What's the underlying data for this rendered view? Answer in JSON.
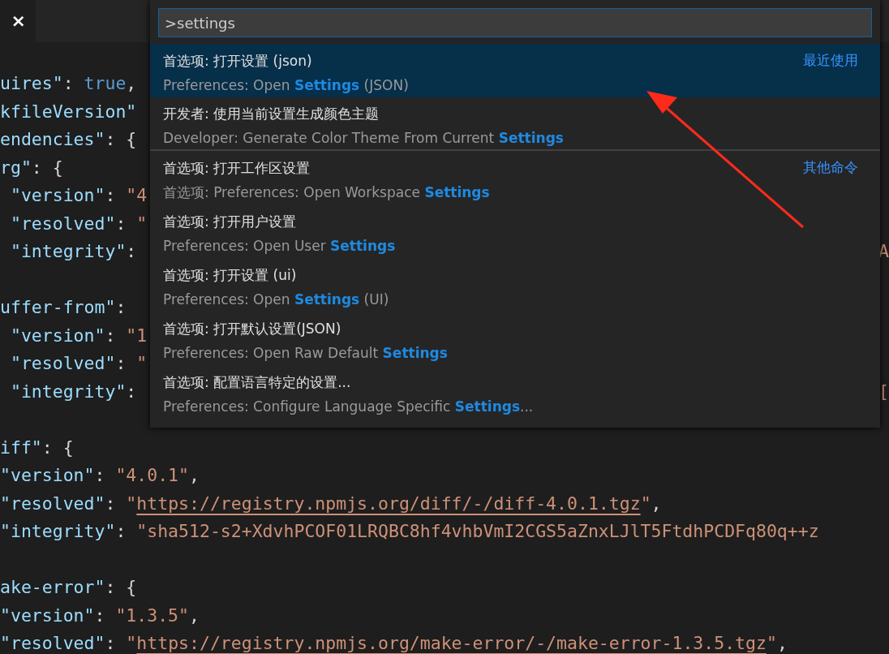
{
  "tab": {
    "close": "×"
  },
  "code_lines": [
    {
      "tokens": [
        {
          "kind": "key",
          "text": "uires\""
        },
        {
          "kind": "punct",
          "text": ": "
        },
        {
          "kind": "bool",
          "text": "true"
        },
        {
          "kind": "punct",
          "text": ","
        }
      ]
    },
    {
      "tokens": [
        {
          "kind": "key",
          "text": "kfileVersion\""
        }
      ]
    },
    {
      "tokens": [
        {
          "kind": "key",
          "text": "endencies\""
        },
        {
          "kind": "punct",
          "text": ": {"
        }
      ]
    },
    {
      "tokens": [
        {
          "kind": "key",
          "text": "rg\""
        },
        {
          "kind": "punct",
          "text": ": {"
        }
      ]
    },
    {
      "tokens": [
        {
          "kind": "key",
          "text": " \"version\""
        },
        {
          "kind": "punct",
          "text": ": "
        },
        {
          "kind": "string",
          "text": "\"4"
        }
      ]
    },
    {
      "tokens": [
        {
          "kind": "key",
          "text": " \"resolved\""
        },
        {
          "kind": "punct",
          "text": ": "
        },
        {
          "kind": "string",
          "text": "\""
        }
      ]
    },
    {
      "tokens": [
        {
          "kind": "key",
          "text": " \"integrity\""
        },
        {
          "kind": "punct",
          "text": ":"
        }
      ],
      "tail": "A"
    },
    {
      "gap_before": true,
      "tokens": [
        {
          "kind": "key",
          "text": "uffer-from\""
        },
        {
          "kind": "punct",
          "text": ":"
        }
      ]
    },
    {
      "tokens": [
        {
          "kind": "key",
          "text": " \"version\""
        },
        {
          "kind": "punct",
          "text": ": "
        },
        {
          "kind": "string",
          "text": "\"1"
        }
      ]
    },
    {
      "tokens": [
        {
          "kind": "key",
          "text": " \"resolved\""
        },
        {
          "kind": "punct",
          "text": ": "
        },
        {
          "kind": "string",
          "text": "\""
        }
      ]
    },
    {
      "tokens": [
        {
          "kind": "key",
          "text": " \"integrity\""
        },
        {
          "kind": "punct",
          "text": ":"
        }
      ],
      "tail": "["
    },
    {
      "gap_before": true,
      "tokens": [
        {
          "kind": "key",
          "text": "iff\""
        },
        {
          "kind": "punct",
          "text": ": {"
        }
      ]
    },
    {
      "tokens": [
        {
          "kind": "key",
          "text": "\"version\""
        },
        {
          "kind": "punct",
          "text": ": "
        },
        {
          "kind": "string",
          "text": "\"4.0.1\""
        },
        {
          "kind": "punct",
          "text": ","
        }
      ]
    },
    {
      "tokens": [
        {
          "kind": "key",
          "text": "\"resolved\""
        },
        {
          "kind": "punct",
          "text": ": "
        },
        {
          "kind": "string",
          "text": "\""
        },
        {
          "kind": "link",
          "text": "https://registry.npmjs.org/diff/-/diff-4.0.1.tgz"
        },
        {
          "kind": "string",
          "text": "\""
        },
        {
          "kind": "punct",
          "text": ","
        }
      ]
    },
    {
      "tokens": [
        {
          "kind": "key",
          "text": "\"integrity\""
        },
        {
          "kind": "punct",
          "text": ": "
        },
        {
          "kind": "string",
          "text": "\"sha512-s2+XdvhPCOF01LRQBC8hf4vhbVmI2CGS5aZnxLJlT5FtdhPCDFq80q++z"
        }
      ]
    },
    {
      "gap_before": true,
      "tokens": [
        {
          "kind": "key",
          "text": "ake-error\""
        },
        {
          "kind": "punct",
          "text": ": {"
        }
      ]
    },
    {
      "tokens": [
        {
          "kind": "key",
          "text": "\"version\""
        },
        {
          "kind": "punct",
          "text": ": "
        },
        {
          "kind": "string",
          "text": "\"1.3.5\""
        },
        {
          "kind": "punct",
          "text": ","
        }
      ]
    },
    {
      "tokens": [
        {
          "kind": "key",
          "text": "\"resolved\""
        },
        {
          "kind": "punct",
          "text": ": "
        },
        {
          "kind": "string",
          "text": "\""
        },
        {
          "kind": "link",
          "text": "https://registry.npmjs.org/make-error/-/make-error-1.3.5.tgz"
        },
        {
          "kind": "string",
          "text": "\""
        },
        {
          "kind": "punct",
          "text": ","
        }
      ]
    }
  ],
  "command_palette": {
    "input": ">settings",
    "items": [
      {
        "label": "首选项: 打开设置 (json)",
        "description": "Preferences: Open **Settings** (JSON)",
        "group_label": "最近使用",
        "selected": true,
        "separator_below": false
      },
      {
        "label": "开发者: 使用当前设置生成颜色主题",
        "description": "Developer: Generate Color Theme From Current **Settings**",
        "selected": false,
        "separator_below": true
      },
      {
        "label": "首选项: 打开工作区设置",
        "description": "首选项: Preferences: Open Workspace **Settings**",
        "group_label": "其他命令",
        "selected": false,
        "separator_below": false
      },
      {
        "label": "首选项: 打开用户设置",
        "description": "Preferences: Open User **Settings**",
        "selected": false,
        "separator_below": false
      },
      {
        "label": "首选项: 打开设置 (ui)",
        "description": "Preferences: Open **Settings** (UI)",
        "selected": false,
        "separator_below": false
      },
      {
        "label": "首选项: 打开默认设置(JSON)",
        "description": "Preferences: Open Raw Default **Settings**",
        "selected": false,
        "separator_below": false
      },
      {
        "label": "首选项: 配置语言特定的设置...",
        "description": "Preferences: Configure Language Specific **Settings**...",
        "selected": false,
        "separator_below": false
      }
    ]
  }
}
